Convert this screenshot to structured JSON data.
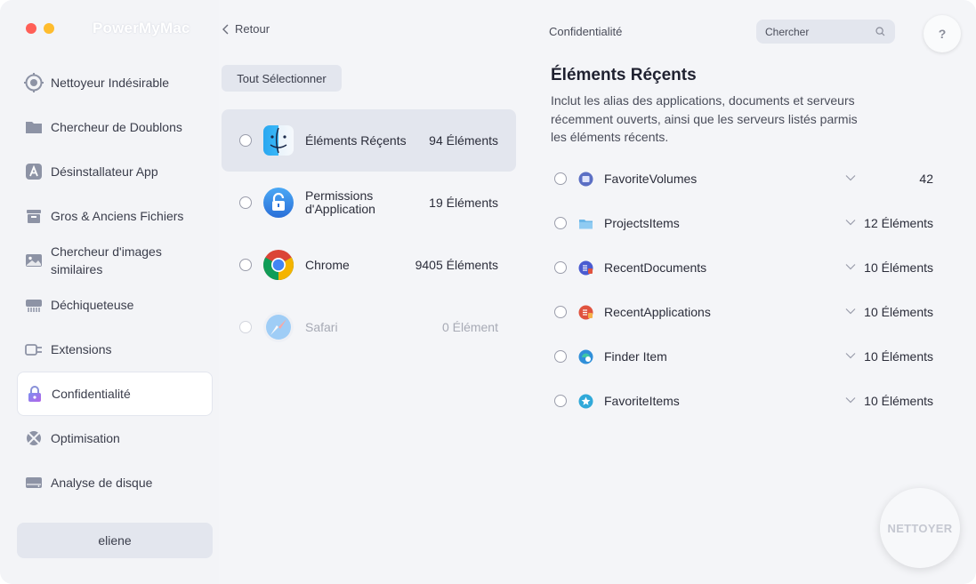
{
  "app": {
    "title": "PowerMyMac"
  },
  "sidebar": {
    "items": [
      {
        "label": "Nettoyeur Indésirable",
        "icon": "junk-cleaner-icon"
      },
      {
        "label": "Chercheur de Doublons",
        "icon": "folder-icon"
      },
      {
        "label": "Désinstallateur App",
        "icon": "app-uninstaller-icon"
      },
      {
        "label": "Gros & Anciens Fichiers",
        "icon": "box-icon"
      },
      {
        "label": "Chercheur d'images similaires",
        "icon": "image-icon"
      },
      {
        "label": "Déchiqueteuse",
        "icon": "shredder-icon"
      },
      {
        "label": "Extensions",
        "icon": "plug-icon"
      },
      {
        "label": "Confidentialité",
        "icon": "lock-icon"
      },
      {
        "label": "Optimisation",
        "icon": "optimization-icon"
      },
      {
        "label": "Analyse de disque",
        "icon": "disk-icon"
      }
    ],
    "active_index": 7,
    "user": "eliene"
  },
  "middle": {
    "back_label": "Retour",
    "select_all_label": "Tout Sélectionner",
    "apps": [
      {
        "name": "Éléments Réçents",
        "count": "94 Éléments",
        "icon": "finder-icon",
        "selected": true
      },
      {
        "name": "Permissions d'Application",
        "count": "19 Éléments",
        "icon": "lock-app-icon",
        "selected": false
      },
      {
        "name": "Chrome",
        "count": "9405 Éléments",
        "icon": "chrome-icon",
        "selected": false
      },
      {
        "name": "Safari",
        "count": "0 Élément",
        "icon": "safari-icon",
        "selected": false,
        "disabled": true
      }
    ]
  },
  "header": {
    "section_title": "Confidentialité",
    "search_placeholder": "Chercher",
    "help_label": "?"
  },
  "detail": {
    "title": "Éléments Réçents",
    "description": "Inclut les alias des applications, documents et serveurs récemment ouverts, ainsi que les serveurs listés parmis les éléments récents.",
    "items": [
      {
        "name": "FavoriteVolumes",
        "count": "42",
        "icon": "volume-icon",
        "color": "#5b6fc4"
      },
      {
        "name": "ProjectsItems",
        "count": "12 Éléments",
        "icon": "folder-icon",
        "color": "#6cb7e8"
      },
      {
        "name": "RecentDocuments",
        "count": "10 Éléments",
        "icon": "document-icon",
        "color": "#4a5bd1"
      },
      {
        "name": "RecentApplications",
        "count": "10 Éléments",
        "icon": "application-icon",
        "color": "#e0533f"
      },
      {
        "name": "Finder Item",
        "count": "10 Éléments",
        "icon": "finder-item-icon",
        "color": "#2f8fd9"
      },
      {
        "name": "FavoriteItems",
        "count": "10 Éléments",
        "icon": "star-icon",
        "color": "#30a9d9"
      }
    ]
  },
  "actions": {
    "clean_label": "NETTOYER"
  },
  "colors": {
    "accent": "#5b6fc4",
    "selected_row": "#e3e6ee",
    "sidebar_bg": "#f3f4f7"
  }
}
